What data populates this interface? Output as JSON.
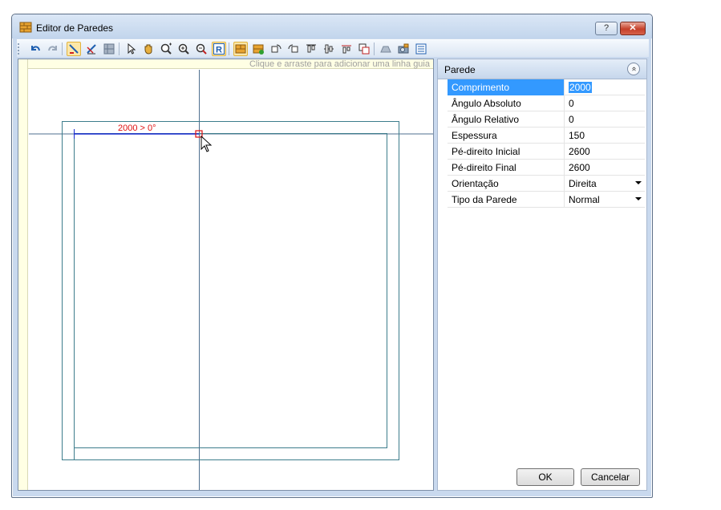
{
  "window": {
    "title": "Editor de Paredes",
    "help_label": "?",
    "close_label": "✕"
  },
  "toolbar": {
    "icons": [
      "undo-icon",
      "redo-icon",
      "draw-wall-icon",
      "edit-wall-icon",
      "grid-icon",
      "select-arrow-icon",
      "pan-hand-icon",
      "zoom-window-icon",
      "zoom-in-icon",
      "zoom-out-icon",
      "regenerate-icon",
      "wall-brick-icon",
      "wall-brick-add-icon",
      "rotate-left-icon",
      "rotate-right-icon",
      "align-top-icon",
      "align-middle-icon",
      "align-bottom-icon",
      "copy-icon",
      "shape-icon",
      "camera-icon",
      "properties-icon"
    ]
  },
  "canvas": {
    "hint": "Clique e arraste para adicionar uma linha guia",
    "dimension_label": "2000 > 0°"
  },
  "properties": {
    "header": "Parede",
    "collapse_label": "«",
    "rows": [
      {
        "name": "Comprimento",
        "value": "2000"
      },
      {
        "name": "Ângulo Absoluto",
        "value": "0"
      },
      {
        "name": "Ângulo Relativo",
        "value": "0"
      },
      {
        "name": "Espessura",
        "value": "150"
      },
      {
        "name": "Pé-direito Inicial",
        "value": "2600"
      },
      {
        "name": "Pé-direito Final",
        "value": "2600"
      },
      {
        "name": "Orientação",
        "value": "Direita"
      },
      {
        "name": "Tipo da Parede",
        "value": "Normal"
      }
    ]
  },
  "buttons": {
    "ok": "OK",
    "cancel": "Cancelar"
  },
  "colors": {
    "wall_line": "#3d7d8c",
    "dimension": "#e01010",
    "guide_line": "#4f6f8f",
    "selection": "#3399ff"
  }
}
